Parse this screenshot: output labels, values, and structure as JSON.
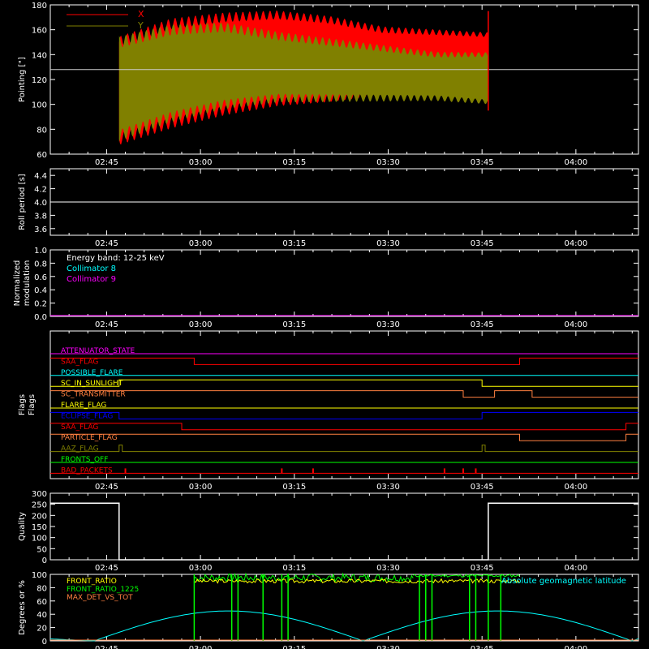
{
  "time_ticks": [
    "02:45",
    "03:00",
    "03:15",
    "03:30",
    "03:45",
    "04:00"
  ],
  "colors": {
    "x_red": "#ff0000",
    "y_olive": "#808000",
    "cyan": "#00ffff",
    "magenta": "#ff00ff",
    "green": "#00ff00",
    "yellow": "#ffff00",
    "orange": "#ff8040",
    "blue": "#0000ff"
  },
  "chart_data": [
    {
      "type": "area",
      "ylabel": "Pointing [\"]",
      "ylim": [
        60,
        180
      ],
      "yticks": [
        "60",
        "80",
        "100",
        "120",
        "140",
        "160",
        "180"
      ],
      "reference_line": 128,
      "legend": {
        "placement": "top-left",
        "entries": [
          "X",
          "Y"
        ]
      },
      "data_start": "02:47",
      "data_end": "03:46",
      "series": [
        {
          "name": "X",
          "envelope_max": [
            150,
            165,
            170,
            172,
            168,
            160,
            158,
            156
          ],
          "envelope_min": [
            72,
            85,
            95,
            102,
            105,
            110,
            112,
            114
          ]
        },
        {
          "name": "Y",
          "envelope_max": [
            150,
            160,
            162,
            155,
            150,
            145,
            140,
            140
          ],
          "envelope_min": [
            75,
            90,
            100,
            105,
            105,
            105,
            105,
            102
          ]
        }
      ]
    },
    {
      "type": "line",
      "ylabel": "Roll period [s]",
      "ylim": [
        3.5,
        4.5
      ],
      "yticks": [
        "3.6",
        "3.8",
        "4.0",
        "4.2",
        "4.4"
      ],
      "value": 4.0
    },
    {
      "type": "line",
      "ylabel": "Normalized",
      "ylabel2": "modulation",
      "ylim": [
        0.0,
        1.0
      ],
      "yticks": [
        "0.0",
        "0.2",
        "0.4",
        "0.6",
        "0.8",
        "1.0"
      ],
      "legend_title": "Energy band: 12-25 keV",
      "series": [
        {
          "name": "Collimator 8",
          "value": 0.0
        },
        {
          "name": "Collimator 9",
          "value": 0.0
        }
      ]
    },
    {
      "type": "line",
      "ylabel": "Flags",
      "flags": [
        {
          "name": "ATTENUATOR_STATE",
          "color": "#ff00ff"
        },
        {
          "name": "SAA_FLAG",
          "color": "#ff0000"
        },
        {
          "name": "POSSIBLE_FLARE",
          "color": "#00ffff"
        },
        {
          "name": "SC_IN_SUNLIGHT",
          "color": "#ffff00"
        },
        {
          "name": "SC_TRANSMITTER",
          "color": "#ff8040"
        },
        {
          "name": "FLARE_FLAG",
          "color": "#ffff00"
        },
        {
          "name": "ECLIPSE_FLAG",
          "color": "#0000ff"
        },
        {
          "name": "SAA_FLAG",
          "color": "#ff0000"
        },
        {
          "name": "PARTICLE_FLAG",
          "color": "#ff8040"
        },
        {
          "name": "AAZ_FLAG",
          "color": "#808000"
        },
        {
          "name": "FRONTS_OFF",
          "color": "#00ff00"
        },
        {
          "name": "BAD_PACKETS",
          "color": "#ff0000"
        }
      ]
    },
    {
      "type": "line",
      "ylabel": "Quality",
      "ylim": [
        0,
        300
      ],
      "yticks": [
        "0",
        "50",
        "100",
        "150",
        "200",
        "250",
        "300"
      ],
      "points": [
        [
          "02:36",
          255
        ],
        [
          "02:47",
          255
        ],
        [
          "02:47",
          0
        ],
        [
          "03:46",
          0
        ],
        [
          "03:46",
          255
        ],
        [
          "04:10",
          255
        ]
      ]
    },
    {
      "type": "line",
      "ylabel": "Degrees or %",
      "ylim": [
        0,
        100
      ],
      "yticks": [
        "0",
        "20",
        "40",
        "60",
        "80",
        "100"
      ],
      "series": [
        {
          "name": "FRONT_RATIO",
          "approx_value": 90
        },
        {
          "name": "FRONT_RATIO_1225",
          "approx_value": 95
        },
        {
          "name": "MAX_DET_VS_TOT",
          "approx_value": 0
        }
      ],
      "annotation": "Absolute geomagnetic latitude"
    }
  ]
}
